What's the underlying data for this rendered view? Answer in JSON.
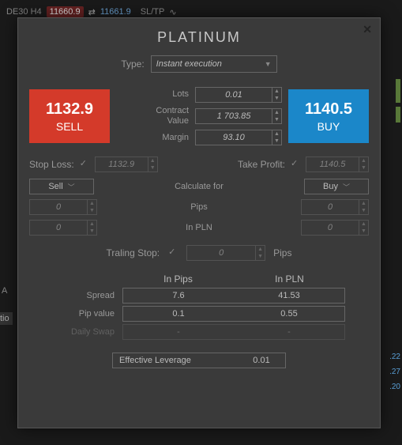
{
  "background": {
    "symbol": "DE30 H4",
    "price1": "11660.9",
    "price2": "11661.9",
    "sltp": "SL/TP",
    "letter_a": "A",
    "tio": "tio",
    "side_nums": [
      ".22",
      ".27",
      ".20"
    ]
  },
  "dialog": {
    "title": "PLATINUM",
    "type_label": "Type:",
    "type_value": "Instant execution",
    "sell": {
      "price": "1132.9",
      "label": "SELL"
    },
    "buy": {
      "price": "1140.5",
      "label": "BUY"
    },
    "fields": {
      "lots": {
        "label": "Lots",
        "value": "0.01"
      },
      "contract_value": {
        "label": "Contract\nValue",
        "value": "1 703.85"
      },
      "margin": {
        "label": "Margin",
        "value": "93.10"
      }
    },
    "stop_loss": {
      "label": "Stop Loss:",
      "value": "1132.9"
    },
    "take_profit": {
      "label": "Take Profit:",
      "value": "1140.5"
    },
    "calculate_for": "Calculate for",
    "sell_btn": "Sell",
    "buy_btn": "Buy",
    "pips_label": "Pips",
    "pips_sell": "0",
    "pips_buy": "0",
    "in_pln_label": "In PLN",
    "pln_sell": "0",
    "pln_buy": "0",
    "trailing": {
      "label": "Traling Stop:",
      "value": "0",
      "unit": "Pips"
    },
    "info": {
      "head_pips": "In Pips",
      "head_pln": "In PLN",
      "spread": {
        "label": "Spread",
        "pips": "7.6",
        "pln": "41.53"
      },
      "pip_value": {
        "label": "Pip value",
        "pips": "0.1",
        "pln": "0.55"
      },
      "daily_swap": {
        "label": "Daily Swap",
        "pips": "-",
        "pln": "-"
      }
    },
    "effective_leverage": {
      "label": "Effective Leverage",
      "value": "0.01"
    }
  }
}
